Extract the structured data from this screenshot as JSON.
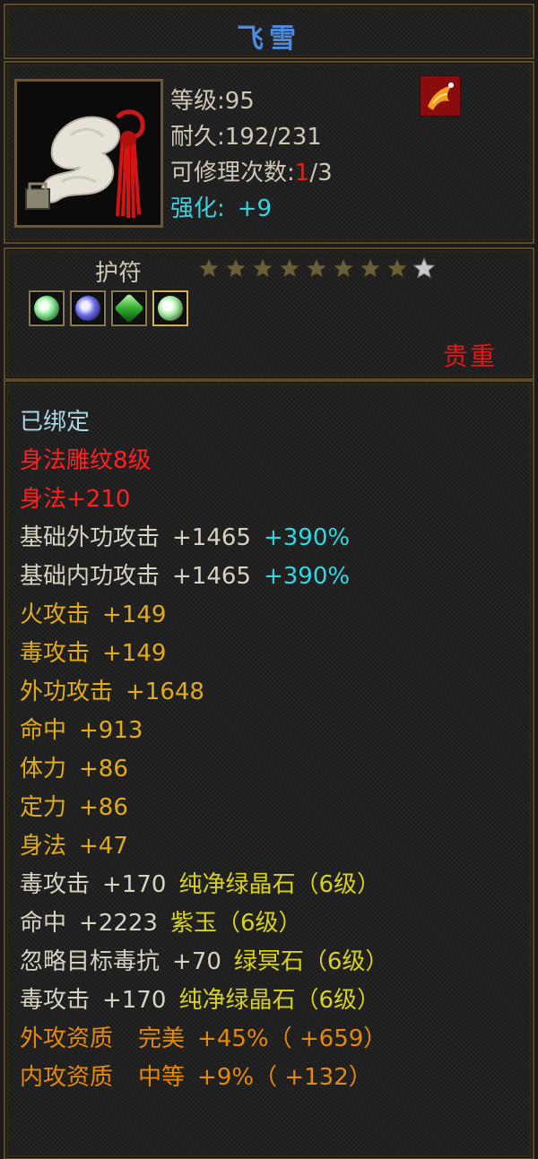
{
  "item": {
    "name": "飞雪",
    "level_text": "等级:95",
    "durability_text": "耐久:192/231",
    "repair_prefix": "可修理次数:",
    "repair_used": "1",
    "repair_suffix": "/3",
    "refine_label": "强化:",
    "refine_value": "+9",
    "type": "护符",
    "stars_filled": 8,
    "stars_total": 9,
    "quality": "贵重",
    "gem_slots": [
      "green-gem-icon",
      "blue-gem-icon",
      "emerald-gem-icon",
      "green-gem-icon-gold"
    ]
  },
  "stats": {
    "bound": "已绑定",
    "engrave_line": "身法雕纹8级",
    "engrave_bonus": "身法+210",
    "base_ext_attack": {
      "name": "基础外功攻击",
      "value": "+1465",
      "bonus": "+390%"
    },
    "base_int_attack": {
      "name": "基础内功攻击",
      "value": "+1465",
      "bonus": "+390%"
    },
    "basic": [
      {
        "name": "火攻击",
        "value": "+149"
      },
      {
        "name": "毒攻击",
        "value": "+149"
      },
      {
        "name": "外功攻击",
        "value": "+1648"
      },
      {
        "name": "命中",
        "value": "+913"
      },
      {
        "name": "体力",
        "value": "+86"
      },
      {
        "name": "定力",
        "value": "+86"
      },
      {
        "name": "身法",
        "value": "+47"
      }
    ],
    "gems": [
      {
        "name": "毒攻击",
        "value": "+170",
        "gem": "纯净绿晶石（6级）"
      },
      {
        "name": "命中",
        "value": "+2223",
        "gem": "紫玉（6级）"
      },
      {
        "name": "忽略目标毒抗",
        "value": "+70",
        "gem": "绿冥石（6级）"
      },
      {
        "name": "毒攻击",
        "value": "+170",
        "gem": "纯净绿晶石（6级）"
      }
    ],
    "aptitude": [
      {
        "name": "外攻资质",
        "grade": "完美",
        "percent": "+45%",
        "extra": "（ +659）"
      },
      {
        "name": "内攻资质",
        "grade": "中等",
        "percent": "+9%",
        "extra": "（ +132）"
      }
    ]
  },
  "colors": {
    "title": "#4d8ae0",
    "quality": "#e01818",
    "bound": "#a9d8e8",
    "engrave": "#ff2020",
    "bonus_percent": "#30d8e4",
    "basic_stat": "#e2ab19",
    "gem_name": "#d9d21c",
    "aptitude": "#e68a0a"
  }
}
